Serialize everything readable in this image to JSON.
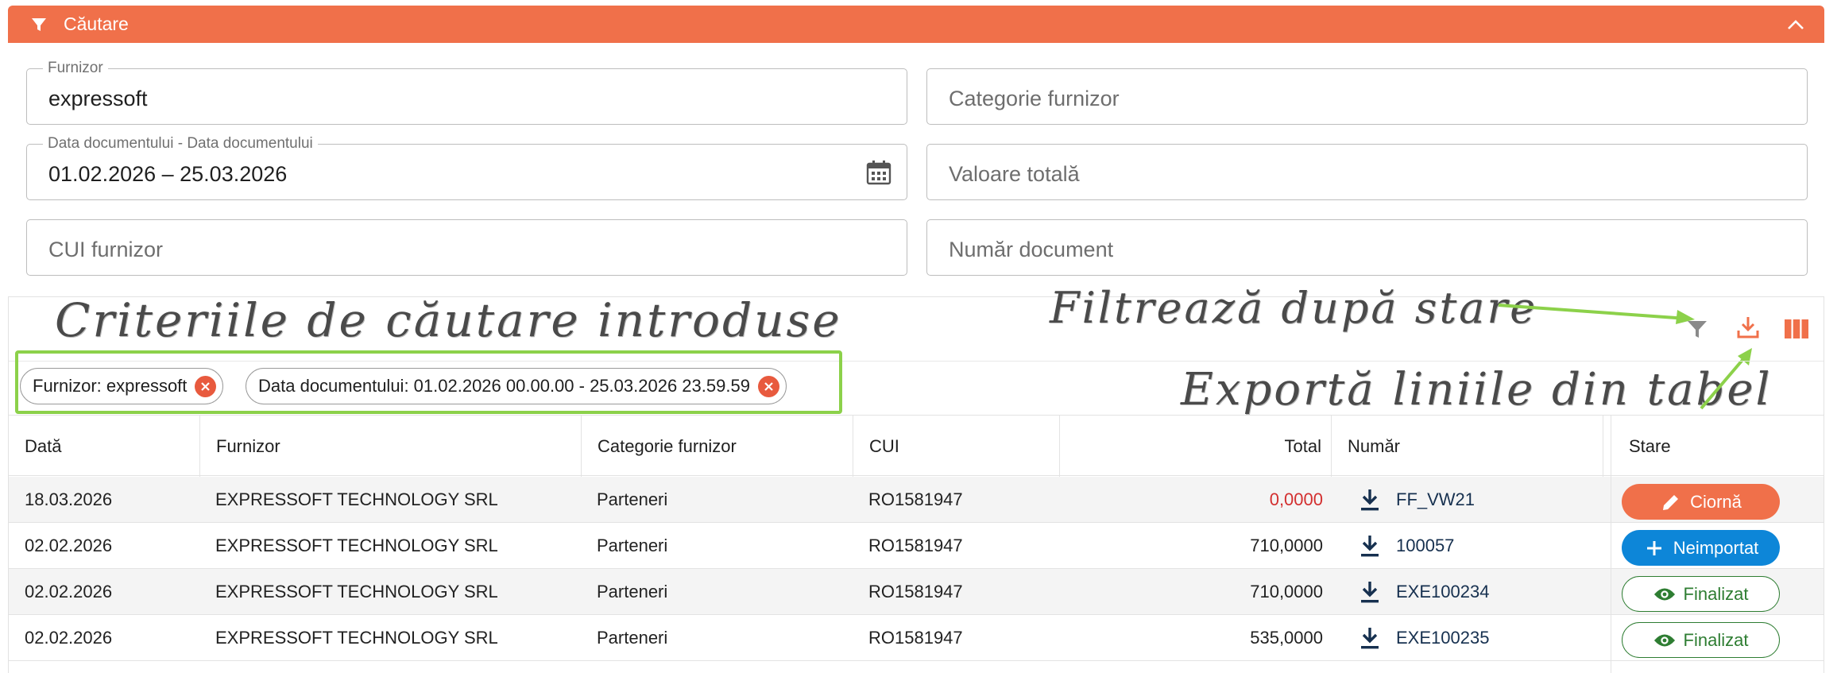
{
  "search": {
    "title": "Căutare",
    "fields": {
      "furnizor_label": "Furnizor",
      "furnizor_value": "expressoft",
      "categorie_placeholder": "Categorie furnizor",
      "data_label": "Data documentului - Data documentului",
      "data_value": "01.02.2026 – 25.03.2026",
      "valoare_placeholder": "Valoare totală",
      "cui_placeholder": "CUI furnizor",
      "numar_placeholder": "Număr document"
    }
  },
  "annotations": {
    "criterii": "Criteriile de căutare introduse",
    "filtreaza": "Filtrează după stare",
    "exporta": "Exportă liniile din tabel"
  },
  "chips": [
    {
      "label": "Furnizor: expressoft"
    },
    {
      "label": "Data documentului: 01.02.2026 00.00.00 - 25.03.2026 23.59.59"
    }
  ],
  "table": {
    "headers": {
      "data": "Dată",
      "furnizor": "Furnizor",
      "categorie": "Categorie furnizor",
      "cui": "CUI",
      "total": "Total",
      "numar": "Număr",
      "stare": "Stare"
    },
    "rows": [
      {
        "data": "18.03.2026",
        "furnizor": "EXPRESSOFT TECHNOLOGY SRL",
        "categorie": "Parteneri",
        "cui": "RO1581947",
        "total": "0,0000",
        "numar": "FF_VW21",
        "stare": "Ciornă"
      },
      {
        "data": "02.02.2026",
        "furnizor": "EXPRESSOFT TECHNOLOGY SRL",
        "categorie": "Parteneri",
        "cui": "RO1581947",
        "total": "710,0000",
        "numar": "100057",
        "stare": "Neimportat"
      },
      {
        "data": "02.02.2026",
        "furnizor": "EXPRESSOFT TECHNOLOGY SRL",
        "categorie": "Parteneri",
        "cui": "RO1581947",
        "total": "710,0000",
        "numar": "EXE100234",
        "stare": "Finalizat"
      },
      {
        "data": "02.02.2026",
        "furnizor": "EXPRESSOFT TECHNOLOGY SRL",
        "categorie": "Parteneri",
        "cui": "RO1581947",
        "total": "535,0000",
        "numar": "EXE100235",
        "stare": "Finalizat"
      }
    ]
  },
  "colors": {
    "accent": "#f0704a",
    "annotation_green": "#8cd14a",
    "neimportat_blue": "#0d86d8",
    "finalizat_green": "#2e7d32",
    "zero_total_red": "#d32f2f"
  },
  "icons": [
    "filter-icon",
    "chevron-up-icon",
    "calendar-icon",
    "status-filter-icon",
    "export-download-icon",
    "columns-icon",
    "close-circle-icon",
    "download-icon",
    "pencil-icon",
    "plus-icon",
    "eye-icon"
  ]
}
